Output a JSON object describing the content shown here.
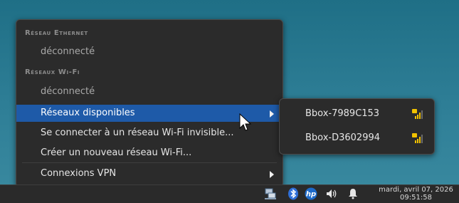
{
  "menu": {
    "ethernet_header": "Réseau Ethernet",
    "ethernet_state": "déconnecté",
    "wifi_header": "Réseaux Wi-Fi",
    "wifi_state": "déconnecté",
    "items": [
      {
        "label": "Réseaux disponibles"
      },
      {
        "label": "Se connecter à un réseau Wi-Fi invisible..."
      },
      {
        "label": "Créer un nouveau réseau Wi-Fi..."
      },
      {
        "label": "Connexions VPN"
      }
    ]
  },
  "submenu": {
    "networks": [
      {
        "ssid": "Bbox-7989C153",
        "icon": "wifi-locked-signal-icon",
        "signal": 0.75
      },
      {
        "ssid": "Bbox-D3602994",
        "icon": "wifi-locked-signal-icon",
        "signal": 0.75
      }
    ]
  },
  "tray": {
    "icons": [
      "network-icon",
      "bluetooth-icon",
      "hp-icon",
      "volume-icon",
      "notification-bell-icon"
    ],
    "date": "mardi, avril 07, 2026",
    "time": "09:51:58"
  },
  "colors": {
    "highlight": "#1e5aa8",
    "menu_bg": "#2b2b2b",
    "lock_yellow": "#f2c200",
    "desktop": "#2a7a90"
  }
}
